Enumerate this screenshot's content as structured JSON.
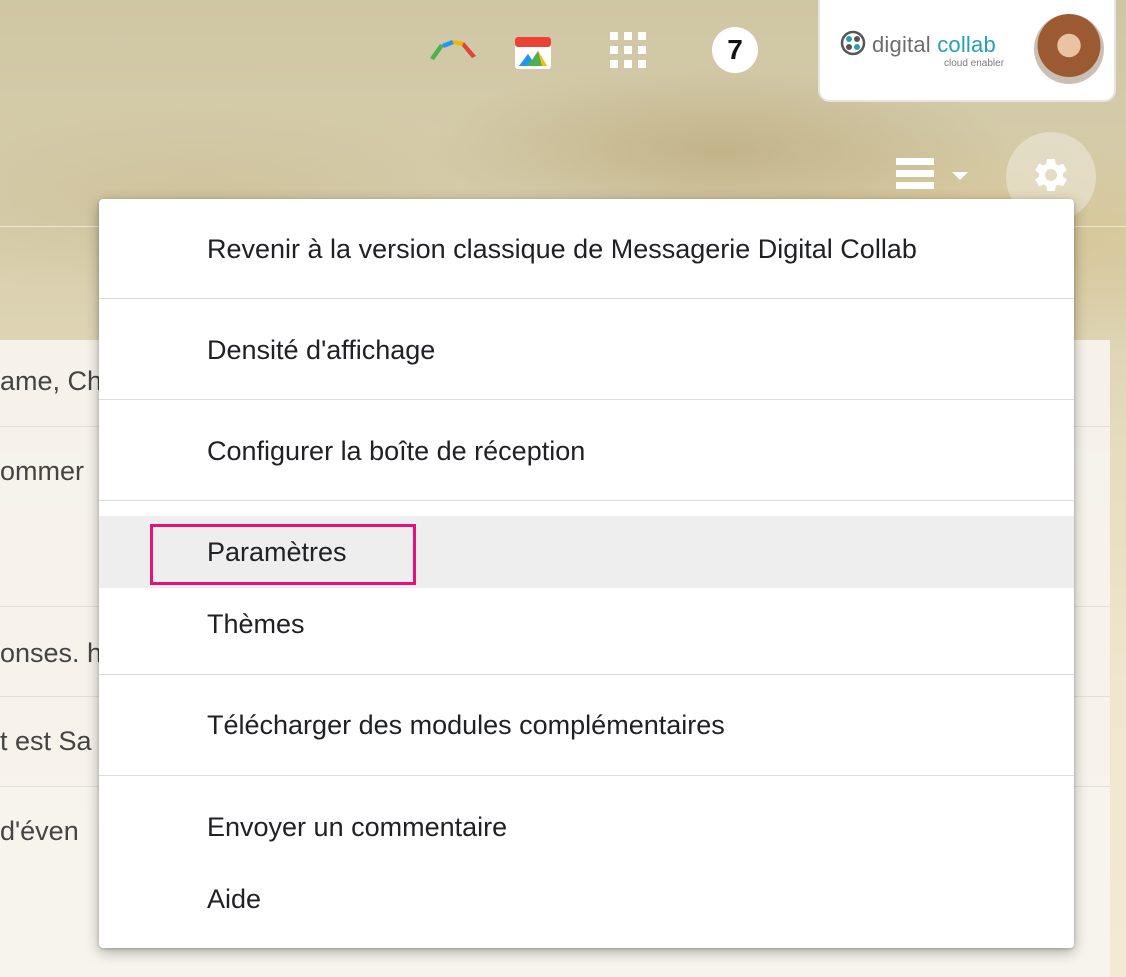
{
  "topbar": {
    "notification_count": "7",
    "account": {
      "brand_name_part1": "digital ",
      "brand_name_part2": "collab",
      "brand_tagline": "cloud enabler"
    }
  },
  "background_list": {
    "rows": [
      "ame, Ch",
      "ommer",
      "onses. h",
      "t est Sa",
      " d'éven"
    ]
  },
  "settings_menu": {
    "items": [
      "Revenir à la version classique de Messagerie Digital Collab",
      "Densité d'affichage",
      "Configurer la boîte de réception",
      "Paramètres",
      "Thèmes",
      "Télécharger des modules complémentaires",
      "Envoyer un commentaire",
      "Aide"
    ],
    "highlighted_item": "Paramètres"
  },
  "colors": {
    "highlight_border": "#e2147c",
    "brand_accent": "#26a0b5",
    "menu_hover_bg": "#eeeeee"
  }
}
